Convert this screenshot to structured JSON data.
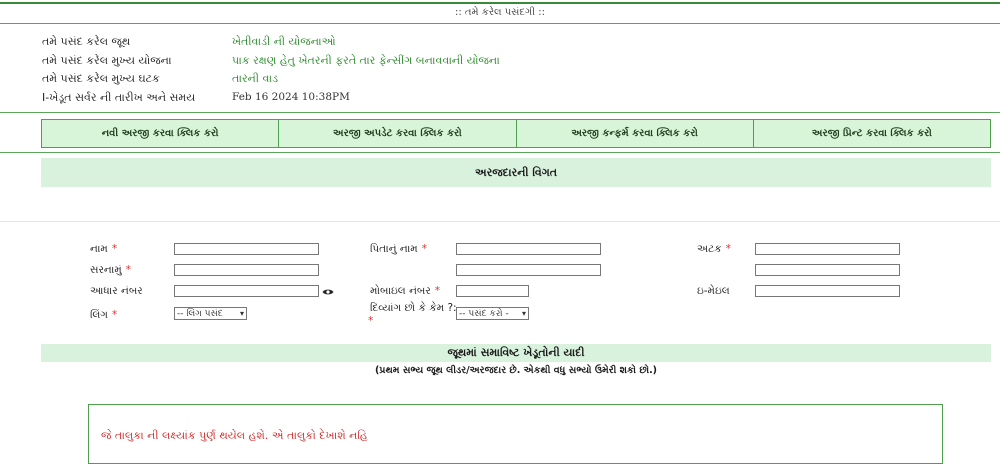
{
  "header": {
    "subtitle": ":: તમે કરેલ પસંદગી ::"
  },
  "selection": [
    {
      "label": "તમે પસંદ કરેલ જૂથ",
      "value": "ખેતીવાડી ની યોજનાઓ"
    },
    {
      "label": "તમે પસંદ કરેલ મુખ્ય યોજના",
      "value": "પાક રક્ષણ હેતુ ખેતરની ફરતે તાર ફેન્સીંગ બનાવવાની યોજના"
    },
    {
      "label": "તમે પસંદ કરેલ મુખ્ય ઘટક",
      "value": "તારની વાડ"
    },
    {
      "label": "I-ખેડૂત સર્વર ની તારીખ અને સમય",
      "value": "Feb 16 2024 10:38PM"
    }
  ],
  "actions": [
    "નવી અરજી કરવા ક્લિક કરો",
    "અરજી અપડેટ કરવા ક્લિક કરો",
    "અરજી કન્ફર્મ કરવા ક્લિક કરો",
    "અરજી પ્રિન્ટ કરવા ક્લિક કરો"
  ],
  "applicant": {
    "heading": "અરજદારની વિગત",
    "name": "નામ",
    "father_name": "પિતાનું નામ",
    "surname_label": "અટક",
    "address": "સરનામું",
    "aadhaar": "આધાર નંબર",
    "mobile": "મોબાઇલ નંબર",
    "email": "ઇ-મેઇલ",
    "gender": "લિંગ",
    "gender_select": "-- લિંગ પસંદ",
    "disabled": "દિવ્યાંગ છો કે કેમ ?:",
    "disabled_select": "-- પસંદ કરો -"
  },
  "required_mark": "*",
  "group": {
    "heading": "જૂથમાં સમાવિષ્ટ ખેડૂતોની યાદી",
    "subheading": "(પ્રથમ સભ્ય જૂથ લીડર/અરજદાર છે. એકથી વધુ સભ્યો ઉમેરી શકો છો.)"
  },
  "notice": "જે તાલુકા ની લક્ષ્યાંક પુર્ણ થયેલ હશે. એ તાલુકો દેખાશે નહિ",
  "colors": {
    "accent_green": "#2e8b2e",
    "panel_green": "#d9f5d9",
    "notice_red": "#d42a2a"
  }
}
